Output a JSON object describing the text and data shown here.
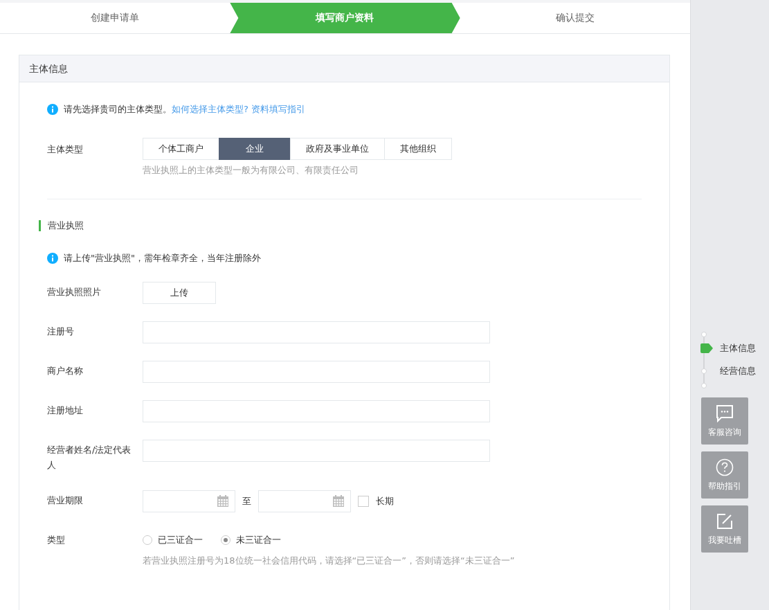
{
  "steps": [
    {
      "label": "创建申请单",
      "selected": false
    },
    {
      "label": "填写商户资料",
      "selected": true
    },
    {
      "label": "确认提交",
      "selected": false
    }
  ],
  "panel": {
    "title": "主体信息",
    "notice": {
      "text": "请先选择贵司的主体类型。",
      "link": "如何选择主体类型? 资料填写指引"
    },
    "subject_type": {
      "label": "主体类型",
      "options": [
        {
          "label": "个体工商户",
          "selected": false
        },
        {
          "label": "企业",
          "selected": true
        },
        {
          "label": "政府及事业单位",
          "selected": false
        },
        {
          "label": "其他组织",
          "selected": false
        }
      ],
      "hint": "营业执照上的主体类型一般为有限公司、有限责任公司"
    },
    "license": {
      "heading": "营业执照",
      "notice": "请上传\"营业执照\"，需年检章齐全，当年注册除外",
      "fields": [
        {
          "kind": "upload",
          "label": "营业执照照片",
          "button": "上传"
        },
        {
          "kind": "text",
          "label": "注册号"
        },
        {
          "kind": "text",
          "label": "商户名称"
        },
        {
          "kind": "text",
          "label": "注册地址"
        },
        {
          "kind": "text",
          "label": "经营者姓名/法定代表人"
        },
        {
          "kind": "daterange",
          "label": "营业期限",
          "separator": "至",
          "checkbox": {
            "label": "长期",
            "checked": false
          }
        },
        {
          "kind": "radio",
          "label": "类型",
          "options": [
            {
              "label": "已三证合一",
              "selected": false
            },
            {
              "label": "未三证合一",
              "selected": true
            }
          ],
          "hint": "若营业执照注册号为18位统一社会信用代码，请选择“已三证合一”，否则请选择“未三证合一”"
        }
      ]
    }
  },
  "sidebar": {
    "nav": [
      {
        "label": "主体信息",
        "selected": true
      },
      {
        "label": "经营信息",
        "selected": false
      }
    ],
    "tools": [
      {
        "label": "客服咨询"
      },
      {
        "label": "帮助指引"
      },
      {
        "label": "我要吐槽"
      }
    ]
  }
}
